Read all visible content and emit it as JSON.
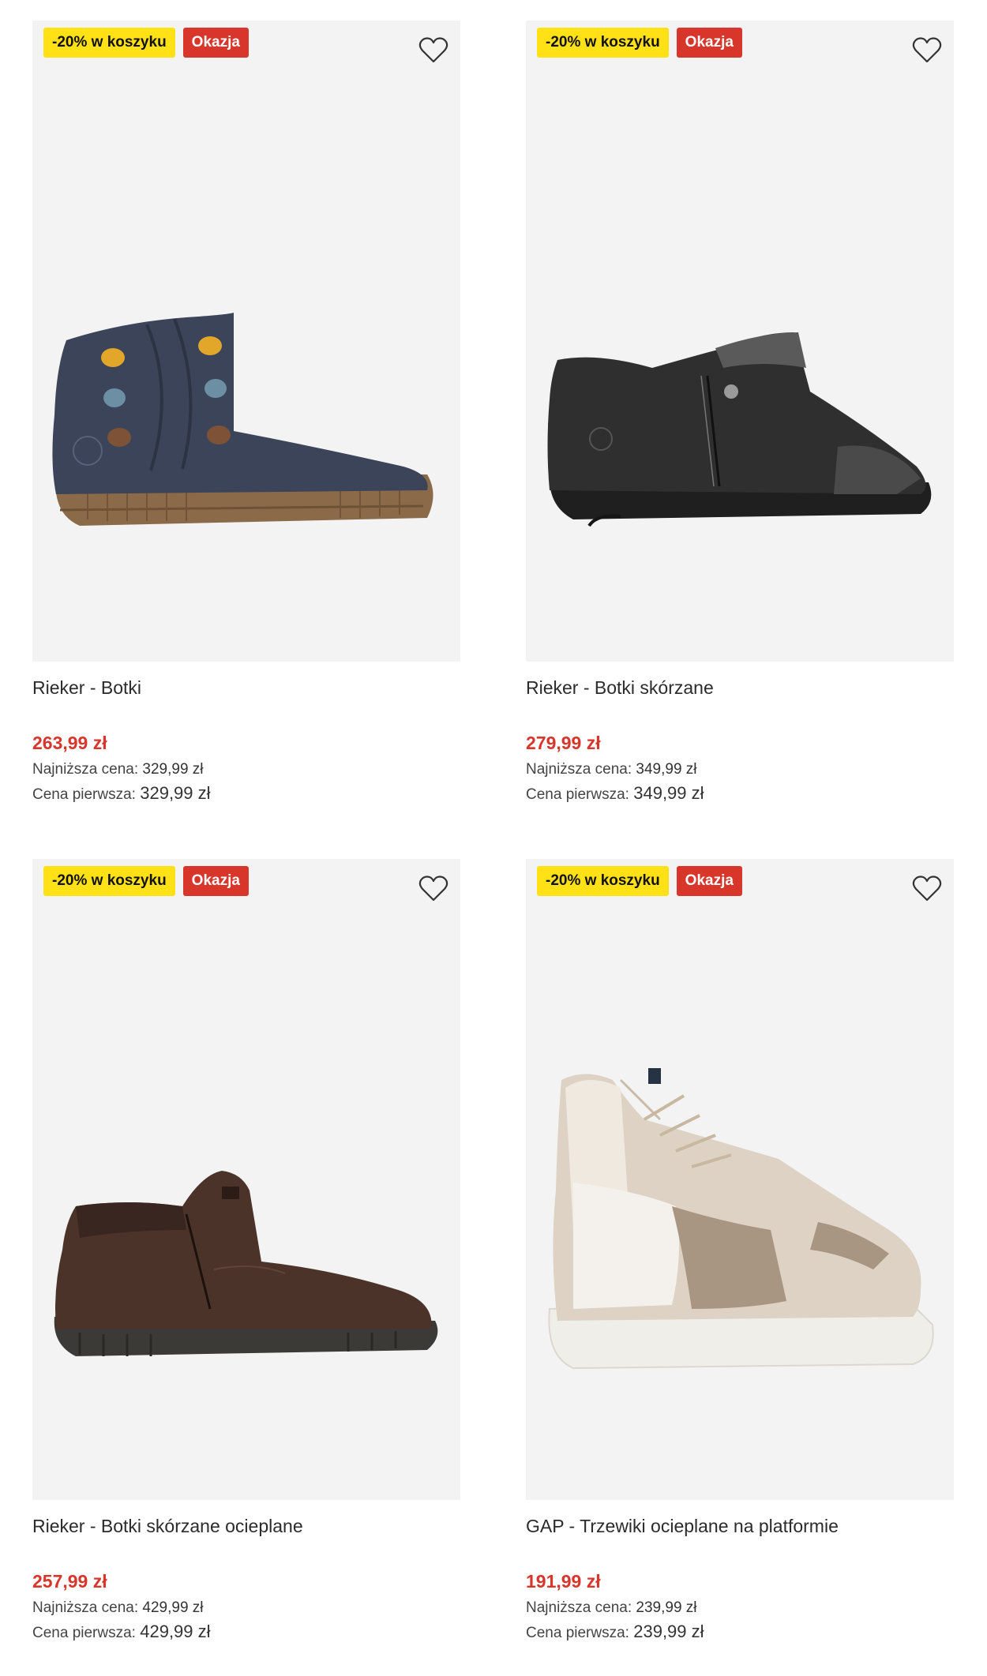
{
  "products": [
    {
      "promo_badge": "-20% w koszyku",
      "deal_badge": "Okazja",
      "title": "Rieker - Botki",
      "price": "263,99 zł",
      "lowest_label": "Najniższa cena:",
      "lowest_value": "329,99 zł",
      "first_label": "Cena pierwsza:",
      "first_value": "329,99 zł",
      "image": "navy-ankle-boot-with-buttons"
    },
    {
      "promo_badge": "-20% w koszyku",
      "deal_badge": "Okazja",
      "title": "Rieker - Botki skórzane",
      "price": "279,99 zł",
      "lowest_label": "Najniższa cena:",
      "lowest_value": "349,99 zł",
      "first_label": "Cena pierwsza:",
      "first_value": "349,99 zł",
      "image": "black-leather-ankle-boot-with-zip"
    },
    {
      "promo_badge": "-20% w koszyku",
      "deal_badge": "Okazja",
      "title": "Rieker - Botki skórzane ocieplane",
      "price": "257,99 zł",
      "lowest_label": "Najniższa cena:",
      "lowest_value": "429,99 zł",
      "first_label": "Cena pierwsza:",
      "first_value": "429,99 zł",
      "image": "brown-leather-boot-with-zip"
    },
    {
      "promo_badge": "-20% w koszyku",
      "deal_badge": "Okazja",
      "title": "GAP - Trzewiki ocieplane na platformie",
      "price": "191,99 zł",
      "lowest_label": "Najniższa cena:",
      "lowest_value": "239,99 zł",
      "first_label": "Cena pierwsza:",
      "first_value": "239,99 zł",
      "image": "beige-white-platform-high-top-sneaker"
    }
  ],
  "colors": {
    "promo_badge_bg": "#ffe115",
    "deal_badge_bg": "#d8352b",
    "price": "#d8352b",
    "image_bg": "#f3f3f3"
  },
  "icons": {
    "wishlist": "heart-outline-icon"
  }
}
